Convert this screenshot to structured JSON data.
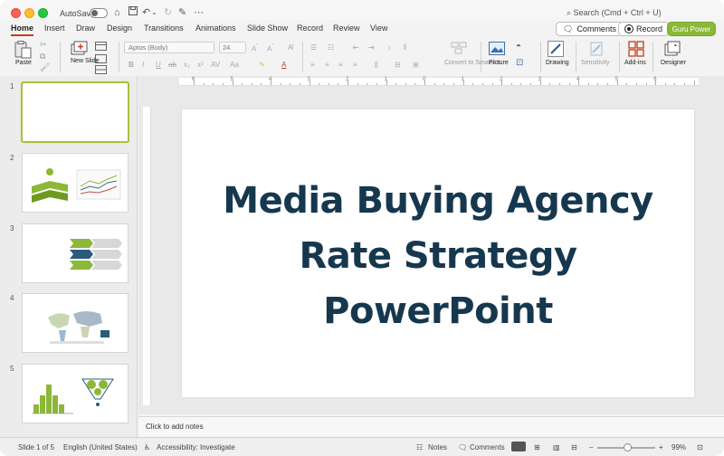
{
  "titlebar": {
    "autosave_label": "AutoSave",
    "search_placeholder": "Search (Cmd + Ctrl + U)"
  },
  "tabs": [
    {
      "label": "Home",
      "active": true
    },
    {
      "label": "Insert"
    },
    {
      "label": "Draw"
    },
    {
      "label": "Design"
    },
    {
      "label": "Transitions"
    },
    {
      "label": "Animations"
    },
    {
      "label": "Slide Show"
    },
    {
      "label": "Record"
    },
    {
      "label": "Review"
    },
    {
      "label": "View"
    }
  ],
  "top_buttons": {
    "comments": "Comments",
    "record": "Record",
    "guru": "Guru Power"
  },
  "ribbon": {
    "paste": "Paste",
    "new_slide": "New Slide",
    "font_name": "Aptos (Body)",
    "font_size": "24",
    "convert_smartart": "Convert to SmartArt",
    "picture": "Picture",
    "drawing": "Drawing",
    "sensitivity": "Sensitivity",
    "addins": "Add-ins",
    "designer": "Designer"
  },
  "ruler_numbers": [
    "6",
    "5",
    "4",
    "3",
    "2",
    "1",
    "0",
    "1",
    "2",
    "3",
    "4",
    "5",
    "6"
  ],
  "slides": [
    {
      "number": "1",
      "selected": true
    },
    {
      "number": "2"
    },
    {
      "number": "3"
    },
    {
      "number": "4"
    },
    {
      "number": "5"
    }
  ],
  "slide": {
    "title_lines": [
      "Media Buying Agency",
      "Rate Strategy",
      "PowerPoint"
    ]
  },
  "notes": {
    "placeholder": "Click to add notes"
  },
  "status": {
    "slide_counter": "Slide 1 of 5",
    "language": "English (United States)",
    "accessibility": "Accessibility: Investigate",
    "notes": "Notes",
    "comments": "Comments",
    "zoom": "99%"
  },
  "colors": {
    "accent_tab": "#c43e1c",
    "guru_button": "#8bb837",
    "title_text": "#16384f",
    "thumb_selected": "#a9bf3f"
  }
}
